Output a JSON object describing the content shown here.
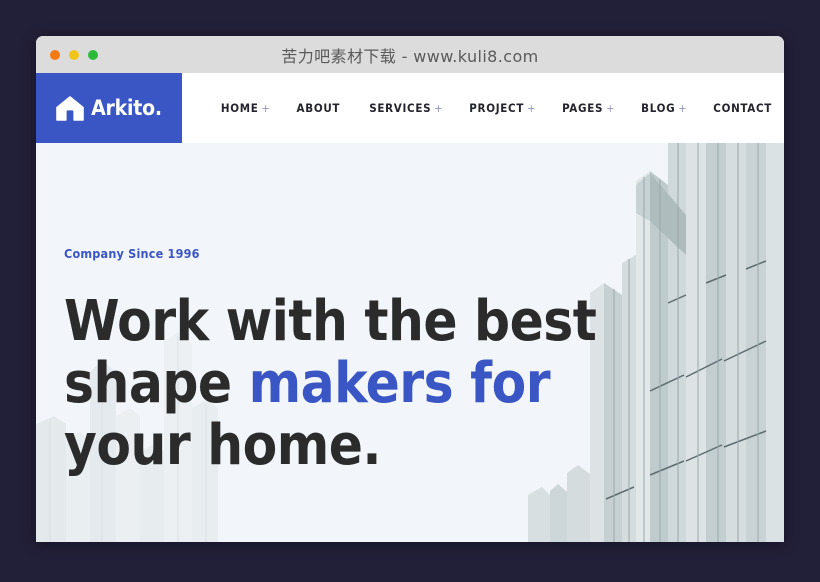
{
  "window": {
    "title": "苦力吧素材下载 - www.kuli8.com",
    "traffic_lights": [
      {
        "name": "close",
        "color": "#f47b12"
      },
      {
        "name": "minimize",
        "color": "#f0c419"
      },
      {
        "name": "maximize",
        "color": "#2cbb39"
      }
    ]
  },
  "site": {
    "logo": {
      "icon": "house-icon",
      "text": "Arkito.",
      "background": "#3a55c4"
    },
    "nav": [
      {
        "label": "HOME",
        "has_submenu": true,
        "plus": "+"
      },
      {
        "label": "ABOUT",
        "has_submenu": false,
        "plus": ""
      },
      {
        "label": "SERVICES",
        "has_submenu": true,
        "plus": "+"
      },
      {
        "label": "PROJECT",
        "has_submenu": true,
        "plus": "+"
      },
      {
        "label": "PAGES",
        "has_submenu": true,
        "plus": "+"
      },
      {
        "label": "BLOG",
        "has_submenu": true,
        "plus": "+"
      },
      {
        "label": "CONTACT",
        "has_submenu": false,
        "plus": ""
      }
    ]
  },
  "hero": {
    "eyebrow": "Company Since 1996",
    "headline_line1": "Work with the best",
    "headline_line2_plain": "shape ",
    "headline_line2_accent": "makers for",
    "headline_line3": "your home.",
    "background": "#f2f6fa",
    "image_alt": "architecture-building-facade"
  },
  "colors": {
    "accent_blue": "#3a55c4",
    "desktop_navy": "#221f38",
    "titlebar_grey": "#dcdcdc",
    "hero_bg": "#f2f6fa",
    "heading_dark": "#2b2b2b",
    "building_grey": "#c3cdd0"
  }
}
